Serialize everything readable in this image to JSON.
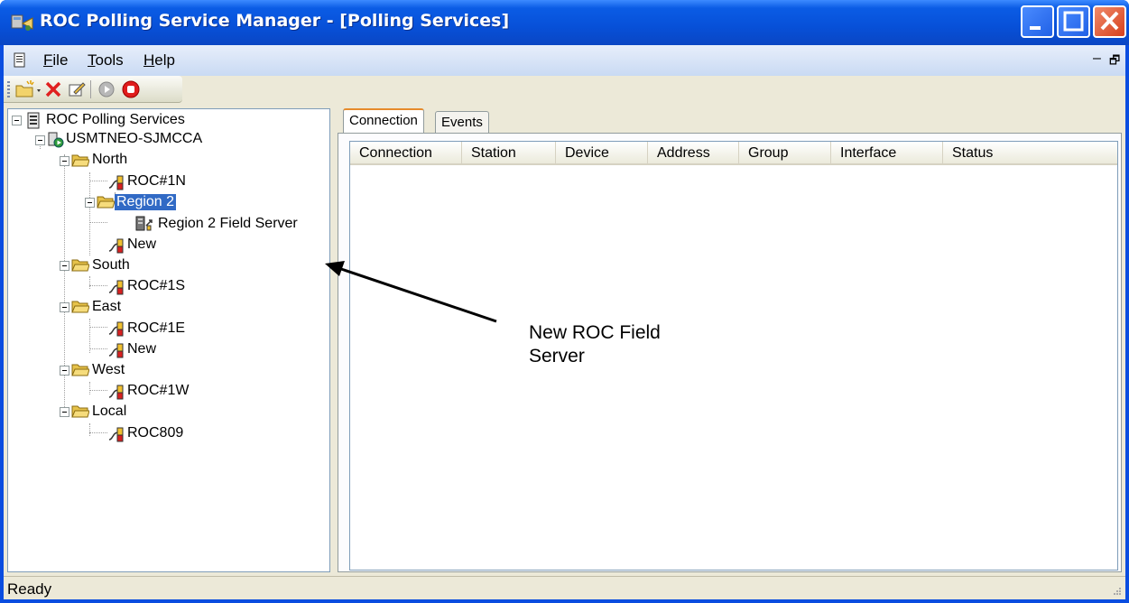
{
  "window": {
    "title": "ROC Polling Service Manager - [Polling Services]"
  },
  "menu": {
    "items": [
      {
        "label": "File",
        "accel": "F",
        "rest": "ile"
      },
      {
        "label": "Tools",
        "accel": "T",
        "rest": "ools"
      },
      {
        "label": "Help",
        "accel": "H",
        "rest": "elp"
      }
    ],
    "mdi_minimize": "–",
    "mdi_restore": "🗗"
  },
  "toolbar": {
    "buttons": [
      "new-folder-icon",
      "delete-icon",
      "properties-icon",
      "start-icon",
      "stop-icon"
    ]
  },
  "tree": {
    "root": "ROC Polling Services",
    "server": "USMTNEO-SJMCCA",
    "north": "North",
    "roc1n": "ROC#1N",
    "region2": "Region 2",
    "region2_field_server": "Region 2 Field Server",
    "north_new": "New",
    "south": "South",
    "roc1s": "ROC#1S",
    "east": "East",
    "roc1e": "ROC#1E",
    "east_new": "New",
    "west": "West",
    "roc1w": "ROC#1W",
    "local": "Local",
    "roc809": "ROC809",
    "selected": "Region 2"
  },
  "tabs": [
    {
      "label": "Connection",
      "active": true
    },
    {
      "label": "Events",
      "active": false
    }
  ],
  "list": {
    "columns": [
      "Connection",
      "Station",
      "Device",
      "Address",
      "Group",
      "Interface",
      "Status"
    ],
    "rows": []
  },
  "callout": {
    "line1": "New ROC Field",
    "line2": "Server"
  },
  "status": {
    "text": "Ready"
  },
  "colors": {
    "titlebar": "#0750d8",
    "selection": "#316ac5",
    "close_button": "#d6401d",
    "tab_accent": "#e68b2c"
  }
}
